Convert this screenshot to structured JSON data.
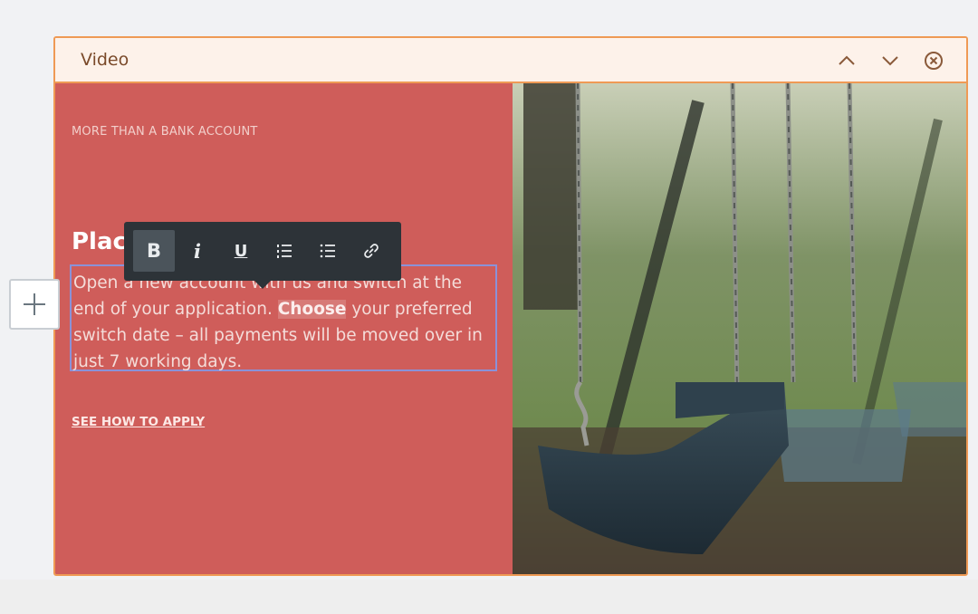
{
  "block": {
    "title": "Video",
    "icons": {
      "move_up": "chevron-up-icon",
      "move_down": "chevron-down-icon",
      "remove": "close-circle-icon"
    }
  },
  "content": {
    "eyebrow": "MORE THAN A BANK ACCOUNT",
    "heading": "Place",
    "paragraph_before": "Open a new account with us and switch at the end of your application. ",
    "paragraph_selected": "Choose",
    "paragraph_after": " your preferred switch date – all payments will be moved over in just 7 working days.",
    "cta_label": "SEE HOW TO APPLY"
  },
  "toolbar": {
    "items": [
      {
        "name": "bold",
        "label": "B",
        "active": true
      },
      {
        "name": "italic",
        "label": "i",
        "active": false
      },
      {
        "name": "underline",
        "label": "U",
        "active": false
      },
      {
        "name": "ordered-list",
        "icon": "ordered-list-icon",
        "active": false
      },
      {
        "name": "bullet-list",
        "icon": "bullet-list-icon",
        "active": false
      },
      {
        "name": "link",
        "icon": "link-icon",
        "active": false
      }
    ]
  },
  "add_block": {
    "icon": "plus-icon"
  },
  "colors": {
    "accent_border": "#ef9a55",
    "panel_red": "#cf5d5a",
    "toolbar_bg": "#2d3338",
    "selection_outline": "#8a92d8"
  }
}
